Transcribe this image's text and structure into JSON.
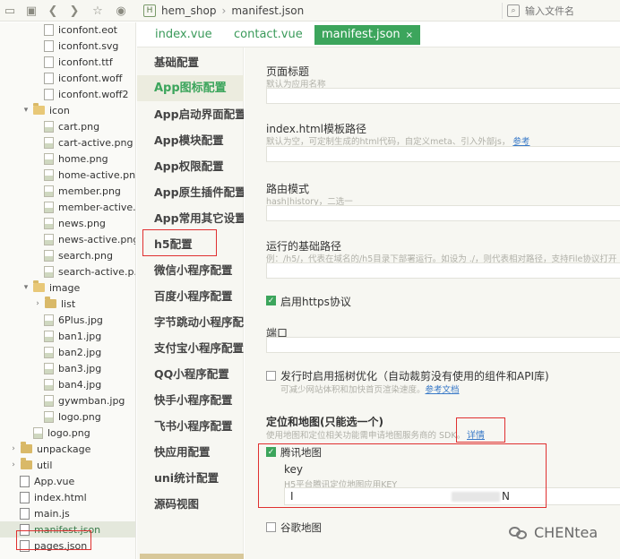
{
  "toolbar": {
    "crumb_icon": "H",
    "project": "hem_shop",
    "file": "manifest.json",
    "search_placeholder": "输入文件名",
    "search_icon_glyph": "⌕"
  },
  "tree": {
    "items": [
      {
        "label": "iconfont.eot",
        "kind": "file"
      },
      {
        "label": "iconfont.svg",
        "kind": "file"
      },
      {
        "label": "iconfont.ttf",
        "kind": "file"
      },
      {
        "label": "iconfont.woff",
        "kind": "file"
      },
      {
        "label": "iconfont.woff2",
        "kind": "file"
      },
      {
        "label": "icon",
        "kind": "folder-open"
      },
      {
        "label": "cart.png",
        "kind": "img"
      },
      {
        "label": "cart-active.png",
        "kind": "img"
      },
      {
        "label": "home.png",
        "kind": "img"
      },
      {
        "label": "home-active.png",
        "kind": "img"
      },
      {
        "label": "member.png",
        "kind": "img"
      },
      {
        "label": "member-active...",
        "kind": "img"
      },
      {
        "label": "news.png",
        "kind": "img"
      },
      {
        "label": "news-active.png",
        "kind": "img"
      },
      {
        "label": "search.png",
        "kind": "img"
      },
      {
        "label": "search-active.p...",
        "kind": "img"
      },
      {
        "label": "image",
        "kind": "folder-open"
      },
      {
        "label": "list",
        "kind": "folder"
      },
      {
        "label": "6Plus.jpg",
        "kind": "img"
      },
      {
        "label": "ban1.jpg",
        "kind": "img"
      },
      {
        "label": "ban2.jpg",
        "kind": "img"
      },
      {
        "label": "ban3.jpg",
        "kind": "img"
      },
      {
        "label": "ban4.jpg",
        "kind": "img"
      },
      {
        "label": "gywmban.jpg",
        "kind": "img"
      },
      {
        "label": "logo.png",
        "kind": "img"
      },
      {
        "label": "logo.png",
        "kind": "img"
      },
      {
        "label": "unpackage",
        "kind": "folder"
      },
      {
        "label": "util",
        "kind": "folder"
      },
      {
        "label": "App.vue",
        "kind": "code"
      },
      {
        "label": "index.html",
        "kind": "code"
      },
      {
        "label": "main.js",
        "kind": "code"
      },
      {
        "label": "manifest.json",
        "kind": "code"
      },
      {
        "label": "pages.json",
        "kind": "code"
      }
    ]
  },
  "tabs": [
    {
      "label": "index.vue"
    },
    {
      "label": "contact.vue"
    },
    {
      "label": "manifest.json",
      "close": "×"
    }
  ],
  "nav": [
    "基础配置",
    "App图标配置",
    "App启动界面配置",
    "App模块配置",
    "App权限配置",
    "App原生插件配置",
    "App常用其它设置",
    "h5配置",
    "微信小程序配置",
    "百度小程序配置",
    "字节跳动小程序配置",
    "支付宝小程序配置",
    "QQ小程序配置",
    "快手小程序配置",
    "飞书小程序配置",
    "快应用配置",
    "uni统计配置",
    "源码视图"
  ],
  "content": {
    "page_title_label": "页面标题",
    "page_title_hint": "默认为应用名称",
    "template_label": "index.html模板路径",
    "template_hint": "默认为空，可定制生成的html代码，自定义meta、引入外部js，",
    "template_link": "参考",
    "router_label": "路由模式",
    "router_hint": "hash|history，二选一",
    "base_label": "运行的基础路径",
    "base_hint": "例：/h5/，代表在域名的/h5目录下部署运行。如设为 ./，则代表相对路径，支持File协议打开",
    "https_label": "启用https协议",
    "port_label": "端口",
    "treeshake_label": "发行时启用摇树优化（自动裁剪没有使用的组件和API库)",
    "treeshake_hint": "可减少网站体积和加快首页渲染速度。",
    "treeshake_link": "参考文档",
    "map_title": "定位和地图(只能选一个)",
    "map_hint": "使用地图和定位相关功能需申请地图服务商的 SDK。",
    "map_link": "详情",
    "tencent_label": "腾讯地图",
    "key_label": "key",
    "key_hint": "H5平台腾讯定位地图应用KEY",
    "key_value_start": "I",
    "key_value_end": "N",
    "google_label": "谷歌地图",
    "check_glyph": "✓"
  },
  "watermark": {
    "text": "CHENtea"
  },
  "colors": {
    "accent": "#3ca55c",
    "annotation": "#e03030",
    "link": "#3a7ac8"
  }
}
